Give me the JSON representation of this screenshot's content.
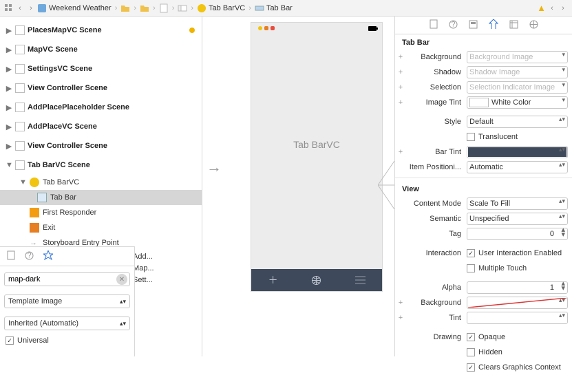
{
  "jumpbar": {
    "project": "Weekend Weather",
    "tabvc": "Tab BarVC",
    "tabbar": "Tab Bar"
  },
  "scenes": [
    {
      "label": "PlacesMapVC Scene",
      "warn": true
    },
    {
      "label": "MapVC Scene"
    },
    {
      "label": "SettingsVC Scene"
    },
    {
      "label": "View Controller Scene"
    },
    {
      "label": "AddPlacePlaceholder Scene"
    },
    {
      "label": "AddPlaceVC Scene"
    },
    {
      "label": "View Controller Scene"
    }
  ],
  "expandedScene": {
    "label": "Tab BarVC Scene",
    "children": [
      {
        "kind": "tabc",
        "label": "Tab BarVC"
      },
      {
        "kind": "sq",
        "label": "Tab Bar",
        "selected": true
      },
      {
        "kind": "cube",
        "label": "First Responder"
      },
      {
        "kind": "exit",
        "label": "Exit"
      },
      {
        "kind": "arrow",
        "label": "Storyboard Entry Point"
      }
    ]
  },
  "partials": [
    "rollers\" to \"Add...",
    "rollers\" to \"Map...",
    "rollers\" to \"Sett..."
  ],
  "attrPanel": {
    "name": "map-dark",
    "rendering": "Template Image",
    "trait": "Inherited (Automatic)",
    "universal": "Universal"
  },
  "phone": {
    "title": "Tab BarVC"
  },
  "inspector": {
    "sec1": "Tab Bar",
    "background_label": "Background",
    "background": "Background Image",
    "shadow_label": "Shadow",
    "shadow": "Shadow Image",
    "selection_label": "Selection",
    "selection": "Selection Indicator Image",
    "imageTint_label": "Image Tint",
    "imageTint": "White Color",
    "style_label": "Style",
    "style": "Default",
    "translucent": "Translucent",
    "barTint_label": "Bar Tint",
    "itemPos_label": "Item Positioni...",
    "itemPos": "Automatic",
    "sec2": "View",
    "contentMode_label": "Content Mode",
    "contentMode": "Scale To Fill",
    "semantic_label": "Semantic",
    "semantic": "Unspecified",
    "tag_label": "Tag",
    "tag": "0",
    "interaction_label": "Interaction",
    "uie": "User Interaction Enabled",
    "mt": "Multiple Touch",
    "alpha_label": "Alpha",
    "alpha": "1",
    "bg2_label": "Background",
    "tint2_label": "Tint",
    "drawing_label": "Drawing",
    "opaque": "Opaque",
    "hidden": "Hidden",
    "cgc": "Clears Graphics Context"
  }
}
